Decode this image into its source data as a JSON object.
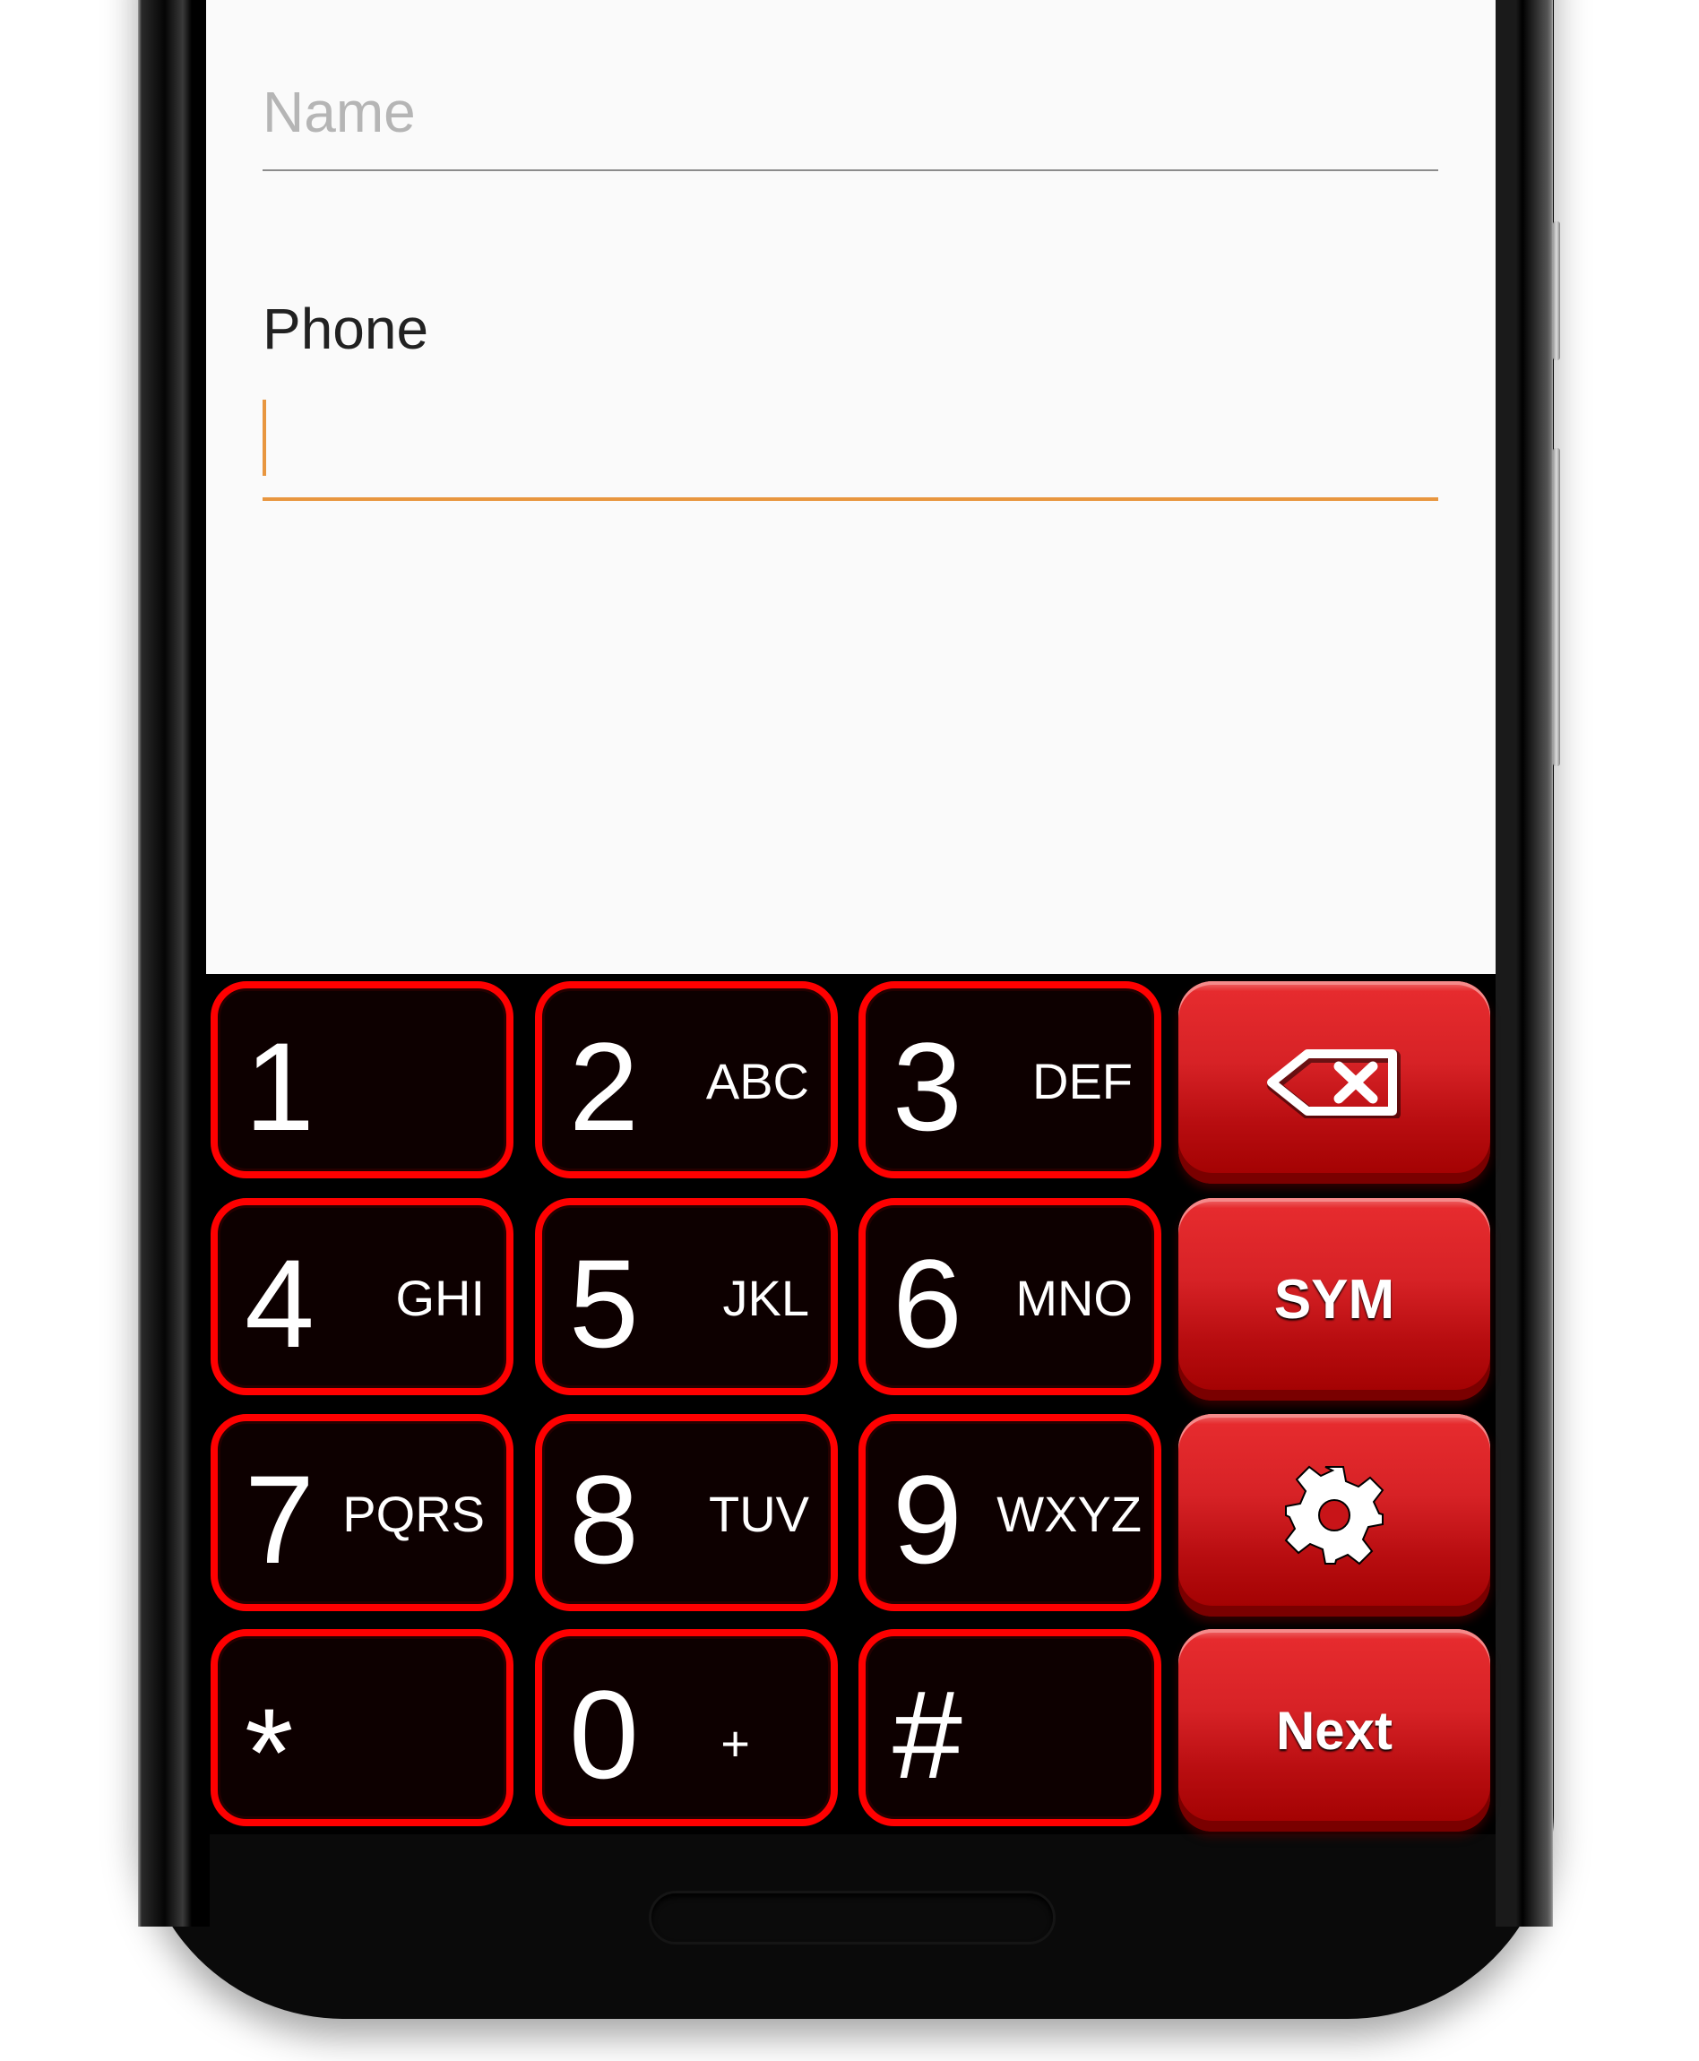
{
  "form": {
    "name_field": {
      "label": "",
      "placeholder": "Name",
      "value": ""
    },
    "phone_field": {
      "label": "Phone",
      "value": "",
      "focused": true
    }
  },
  "colors": {
    "accent": "#e8963f",
    "key_border": "#ff0000",
    "function_key": "#d72226",
    "screen_bg": "#fafafa"
  },
  "keyboard": {
    "keys": [
      {
        "digit": "1",
        "letters": ""
      },
      {
        "digit": "2",
        "letters": "ABC"
      },
      {
        "digit": "3",
        "letters": "DEF"
      },
      {
        "digit": "4",
        "letters": "GHI"
      },
      {
        "digit": "5",
        "letters": "JKL"
      },
      {
        "digit": "6",
        "letters": "MNO"
      },
      {
        "digit": "7",
        "letters": "PQRS"
      },
      {
        "digit": "8",
        "letters": "TUV"
      },
      {
        "digit": "9",
        "letters": "WXYZ"
      },
      {
        "digit": "*",
        "letters": ""
      },
      {
        "digit": "0",
        "letters": "+"
      },
      {
        "digit": "#",
        "letters": ""
      }
    ],
    "function_keys": {
      "backspace": {
        "icon": "backspace-icon"
      },
      "sym": {
        "label": "SYM"
      },
      "settings": {
        "icon": "gear-icon"
      },
      "next": {
        "label": "Next"
      }
    }
  }
}
